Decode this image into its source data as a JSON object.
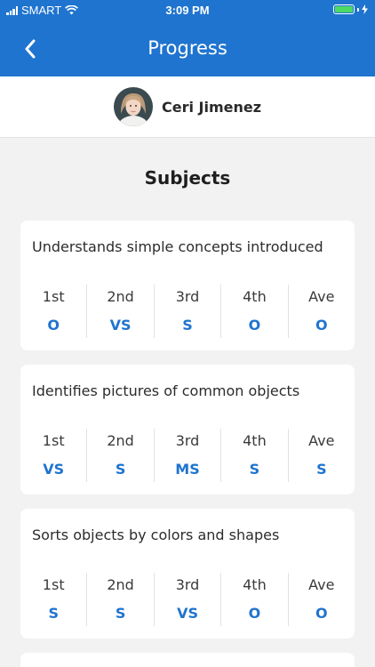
{
  "status": {
    "carrier": "SMART",
    "time": "3:09 PM",
    "battery_level": 1.0
  },
  "nav": {
    "title": "Progress",
    "back_icon": "chevron-left-icon"
  },
  "profile": {
    "name": "Ceri Jimenez"
  },
  "section": {
    "title": "Subjects"
  },
  "subjects": [
    {
      "title": "Understands simple concepts introduced",
      "grades": [
        {
          "label": "1st",
          "value": "O"
        },
        {
          "label": "2nd",
          "value": "VS"
        },
        {
          "label": "3rd",
          "value": "S"
        },
        {
          "label": "4th",
          "value": "O"
        },
        {
          "label": "Ave",
          "value": "O"
        }
      ]
    },
    {
      "title": "Identifies pictures of common objects",
      "grades": [
        {
          "label": "1st",
          "value": "VS"
        },
        {
          "label": "2nd",
          "value": "S"
        },
        {
          "label": "3rd",
          "value": "MS"
        },
        {
          "label": "4th",
          "value": "S"
        },
        {
          "label": "Ave",
          "value": "S"
        }
      ]
    },
    {
      "title": "Sorts objects by colors and shapes",
      "grades": [
        {
          "label": "1st",
          "value": "S"
        },
        {
          "label": "2nd",
          "value": "S"
        },
        {
          "label": "3rd",
          "value": "VS"
        },
        {
          "label": "4th",
          "value": "O"
        },
        {
          "label": "Ave",
          "value": "O"
        }
      ]
    }
  ],
  "colors": {
    "primary": "#1f74cf",
    "background": "#f2f2f2",
    "battery": "#4cd964"
  }
}
